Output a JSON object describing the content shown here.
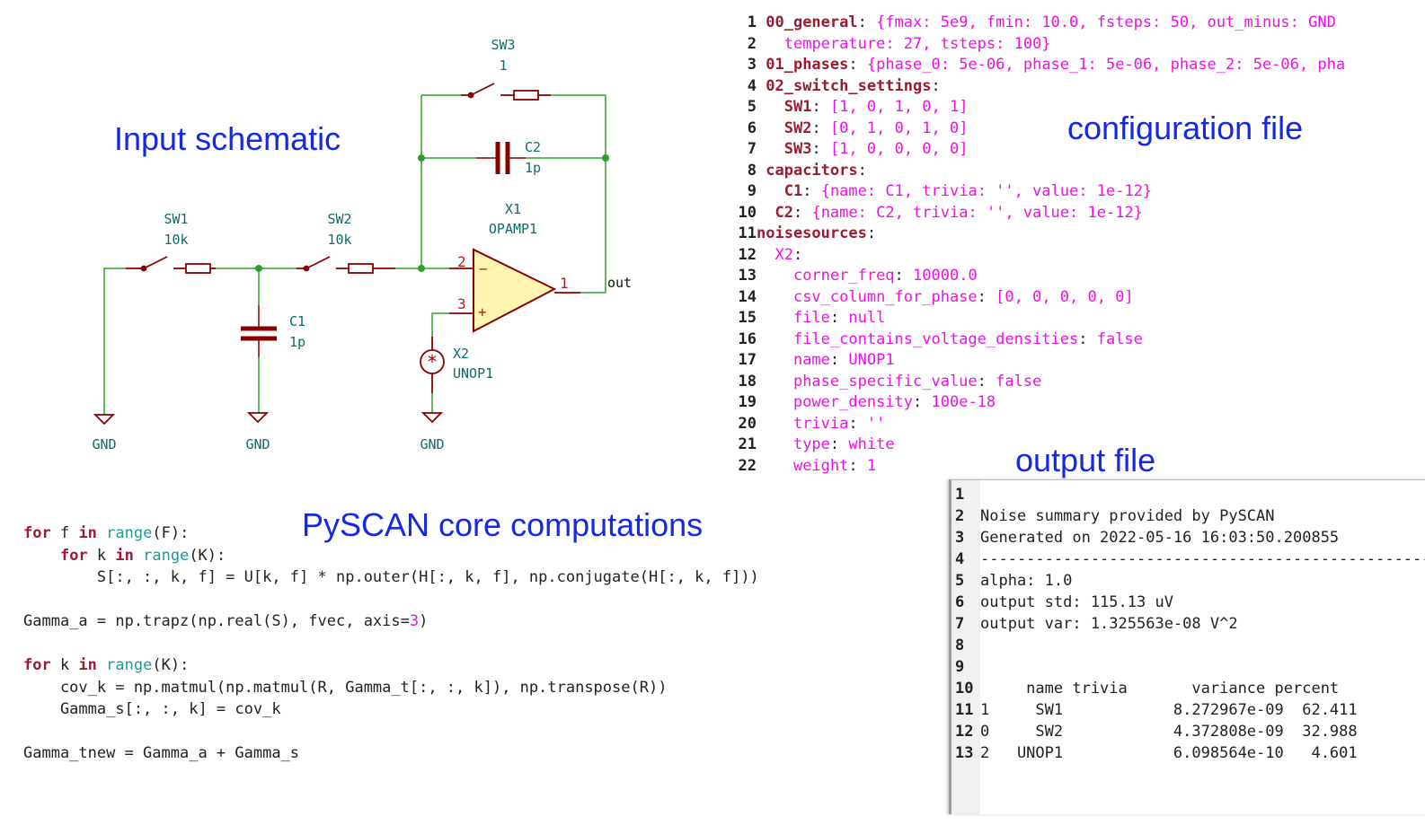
{
  "captions": {
    "schematic": "Input schematic",
    "config": "configuration file",
    "output": "output file",
    "core": "PySCAN core computations"
  },
  "schematic": {
    "components": {
      "sw1": {
        "ref": "SW1",
        "value": "10k"
      },
      "sw2": {
        "ref": "SW2",
        "value": "10k"
      },
      "sw3": {
        "ref": "SW3",
        "value": "1"
      },
      "c1": {
        "ref": "C1",
        "value": "1p"
      },
      "c2": {
        "ref": "C2",
        "value": "1p"
      },
      "x1": {
        "ref": "X1",
        "value": "OPAMP1"
      },
      "x2": {
        "ref": "X2",
        "value": "UNOP1"
      }
    },
    "pins": {
      "inv": "2",
      "noninv": "3",
      "out": "1",
      "minus_sign": "−",
      "plus_sign": "+"
    },
    "net_out": "out",
    "gnd_label": "GND",
    "colors": {
      "wire": "#2ca02c",
      "component": "#8b0000",
      "opamp_fill": "#fff5b0",
      "label": "#0d6b6b"
    }
  },
  "config_file": {
    "lines": [
      {
        "n": "1",
        "indent": "",
        "key": "00_general",
        "rest": " {fmax: 5e9, fmin: 10.0, fsteps: 50, out_minus: GND",
        "pre": ": "
      },
      {
        "n": "2",
        "indent": "  ",
        "key": "",
        "rest": "temperature: 27, tsteps: 100}",
        "pre": ""
      },
      {
        "n": "3",
        "indent": "",
        "key": "01_phases",
        "rest": " {phase_0: 5e-06, phase_1: 5e-06, phase_2: 5e-06, pha",
        "pre": ": "
      },
      {
        "n": "4",
        "indent": "",
        "key": "02_switch_settings",
        "rest": "",
        "pre": ":"
      },
      {
        "n": "5",
        "indent": "  ",
        "key": "SW1",
        "rest": " [1, 0, 1, 0, 1]",
        "pre": ":"
      },
      {
        "n": "6",
        "indent": "  ",
        "key": "SW2",
        "rest": " [0, 1, 0, 1, 0]",
        "pre": ":"
      },
      {
        "n": "7",
        "indent": "  ",
        "key": "SW3",
        "rest": " [1, 0, 0, 0, 0]",
        "pre": ":"
      },
      {
        "n": "8",
        "indent": "",
        "key": "capacitors",
        "rest": "",
        "pre": ":"
      },
      {
        "n": "9",
        "indent": "  ",
        "key": "C1",
        "rest": " {name: C1, trivia: '', value: 1e-12}",
        "pre": ":"
      },
      {
        "n": "10",
        "indent": "  ",
        "key": "C2",
        "rest": " {name: C2, trivia: '', value: 1e-12}",
        "pre": ":"
      },
      {
        "n": "11",
        "indent": "",
        "key": "noisesources",
        "rest": "",
        "pre": ":"
      },
      {
        "n": "12",
        "indent": "  ",
        "key": "X2",
        "rest": "",
        "pre": ":"
      },
      {
        "n": "13",
        "indent": "    ",
        "key": "corner_freq",
        "rest": " 10000.0",
        "pre": ":"
      },
      {
        "n": "14",
        "indent": "    ",
        "key": "csv_column_for_phase",
        "rest": " [0, 0, 0, 0, 0]",
        "pre": ":"
      },
      {
        "n": "15",
        "indent": "    ",
        "key": "file",
        "rest": " null",
        "pre": ":"
      },
      {
        "n": "16",
        "indent": "    ",
        "key": "file_contains_voltage_densities",
        "rest": " false",
        "pre": ":"
      },
      {
        "n": "17",
        "indent": "    ",
        "key": "name",
        "rest": " UNOP1",
        "pre": ":"
      },
      {
        "n": "18",
        "indent": "    ",
        "key": "phase_specific_value",
        "rest": " false",
        "pre": ":"
      },
      {
        "n": "19",
        "indent": "    ",
        "key": "power_density",
        "rest": " 100e-18",
        "pre": ":"
      },
      {
        "n": "20",
        "indent": "    ",
        "key": "trivia",
        "rest": " ''",
        "pre": ":"
      },
      {
        "n": "21",
        "indent": "    ",
        "key": "type",
        "rest": " white",
        "pre": ":"
      },
      {
        "n": "22",
        "indent": "    ",
        "key": "weight",
        "rest": " 1",
        "pre": ":"
      }
    ]
  },
  "output_file": {
    "lines": [
      {
        "n": "1",
        "text": ""
      },
      {
        "n": "2",
        "text": "Noise summary provided by PySCAN"
      },
      {
        "n": "3",
        "text": "Generated on 2022-05-16 16:03:50.200855"
      },
      {
        "n": "4",
        "text": "------------------------------------------------------------"
      },
      {
        "n": "5",
        "text": "alpha: 1.0"
      },
      {
        "n": "6",
        "text": "output std: 115.13 uV"
      },
      {
        "n": "7",
        "text": "output var: 1.325563e-08 V^2"
      },
      {
        "n": "8",
        "text": ""
      },
      {
        "n": "9",
        "text": ""
      },
      {
        "n": "10",
        "text": "     name trivia       variance percent"
      },
      {
        "n": "11",
        "text": "1     SW1            8.272967e-09  62.411"
      },
      {
        "n": "12",
        "text": "0     SW2            4.372808e-09  32.988"
      },
      {
        "n": "13",
        "text": "2   UNOP1            6.098564e-10   4.601"
      }
    ],
    "table": {
      "headers": [
        "",
        "name",
        "trivia",
        "variance",
        "percent"
      ],
      "rows": [
        [
          "1",
          "SW1",
          "",
          "8.272967e-09",
          "62.411"
        ],
        [
          "0",
          "SW2",
          "",
          "4.372808e-09",
          "32.988"
        ],
        [
          "2",
          "UNOP1",
          "",
          "6.098564e-10",
          "4.601"
        ]
      ]
    }
  },
  "code": {
    "lines": [
      [
        {
          "t": "for",
          "c": "kw"
        },
        {
          "t": " f ",
          "c": ""
        },
        {
          "t": "in",
          "c": "kw"
        },
        {
          "t": " ",
          "c": ""
        },
        {
          "t": "range",
          "c": "bi"
        },
        {
          "t": "(F):",
          "c": ""
        }
      ],
      [
        {
          "t": "    ",
          "c": ""
        },
        {
          "t": "for",
          "c": "kw"
        },
        {
          "t": " k ",
          "c": ""
        },
        {
          "t": "in",
          "c": "kw"
        },
        {
          "t": " ",
          "c": ""
        },
        {
          "t": "range",
          "c": "bi"
        },
        {
          "t": "(K):",
          "c": ""
        }
      ],
      [
        {
          "t": "        S[:, :, k, f] = U[k, f] * np.outer(H[:, k, f], np.conjugate(H[:, k, f]))",
          "c": ""
        }
      ],
      [],
      [
        {
          "t": "Gamma_a = np.trapz(np.real(S), fvec, axis=",
          "c": ""
        },
        {
          "t": "3",
          "c": "num"
        },
        {
          "t": ")",
          "c": ""
        }
      ],
      [],
      [
        {
          "t": "for",
          "c": "kw"
        },
        {
          "t": " k ",
          "c": ""
        },
        {
          "t": "in",
          "c": "kw"
        },
        {
          "t": " ",
          "c": ""
        },
        {
          "t": "range",
          "c": "bi"
        },
        {
          "t": "(K):",
          "c": ""
        }
      ],
      [
        {
          "t": "    cov_k = np.matmul(np.matmul(R, Gamma_t[:, :, k]), np.transpose(R))",
          "c": ""
        }
      ],
      [
        {
          "t": "    Gamma_s[:, :, k] = cov_k",
          "c": ""
        }
      ],
      [],
      [
        {
          "t": "Gamma_tnew = Gamma_a + Gamma_s",
          "c": ""
        }
      ]
    ]
  }
}
